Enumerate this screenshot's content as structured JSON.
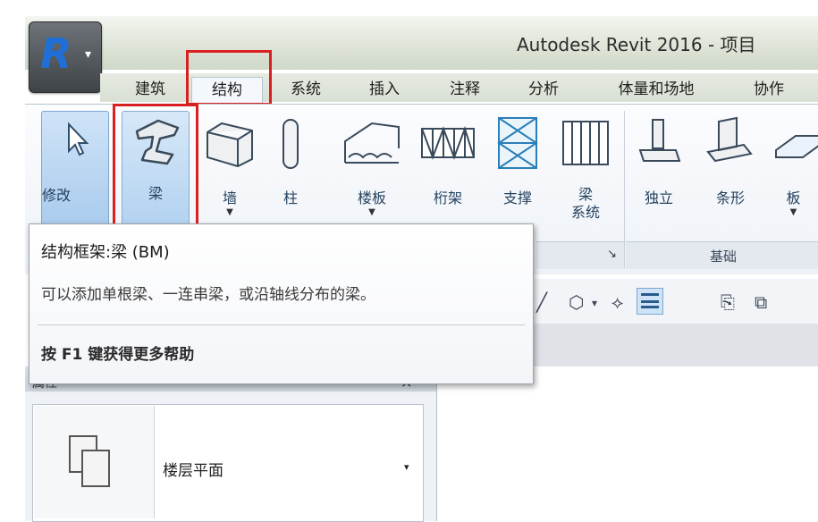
{
  "window": {
    "title": "Autodesk Revit 2016 -    项目"
  },
  "app_menu": {
    "letter": "R",
    "arrow": "▾"
  },
  "tabs": [
    {
      "label": "建筑"
    },
    {
      "label": "结构"
    },
    {
      "label": "系统"
    },
    {
      "label": "插入"
    },
    {
      "label": "注释"
    },
    {
      "label": "分析"
    },
    {
      "label": "体量和场地"
    },
    {
      "label": "协作"
    }
  ],
  "active_tab": "结构",
  "ribbon": {
    "buttons": [
      {
        "label": "修改"
      },
      {
        "label": "梁"
      },
      {
        "label": "墙"
      },
      {
        "label": "柱"
      },
      {
        "label": "楼板"
      },
      {
        "label": "桁架"
      },
      {
        "label": "支撑"
      },
      {
        "label": "梁"
      },
      {
        "label": "系统"
      },
      {
        "label": "独立"
      },
      {
        "label": "条形"
      },
      {
        "label": "板"
      }
    ],
    "panels": {
      "foundation": "基础",
      "launcher": "↘"
    }
  },
  "tooltip": {
    "title": "结构框架:梁 (BM)",
    "description": "可以添加单根梁、一连串梁，或沿轴线分布的梁。",
    "help": "按 F1 键获得更多帮助"
  },
  "properties": {
    "title": "属性",
    "close": "×",
    "type_name": "楼层平面",
    "dropdown": "▾"
  },
  "colors": {
    "highlight": "#d92020",
    "accent": "#1f6fd6"
  }
}
